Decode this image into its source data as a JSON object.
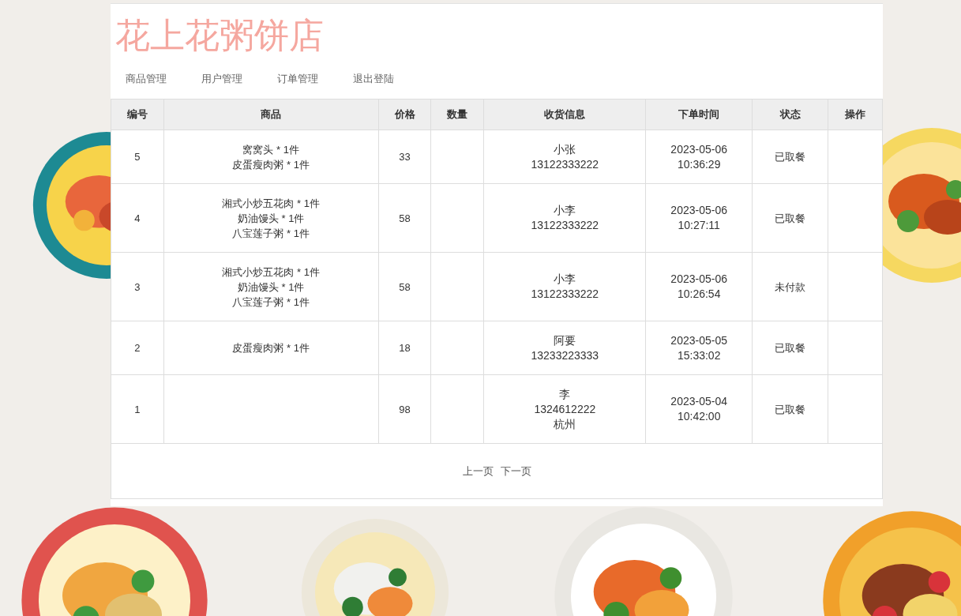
{
  "shop_title": "花上花粥饼店",
  "nav": [
    "商品管理",
    "用户管理",
    "订单管理",
    "退出登陆"
  ],
  "table": {
    "columns": [
      "编号",
      "商品",
      "价格",
      "数量",
      "收货信息",
      "下单时间",
      "状态",
      "操作"
    ],
    "rows": [
      {
        "id": "5",
        "items": [
          "窝窝头 * 1件",
          "皮蛋瘦肉粥 * 1件"
        ],
        "price": "33",
        "receiver": [
          "小张",
          "13122333222"
        ],
        "time": [
          "2023-05-06",
          "10:36:29"
        ],
        "status": "已取餐"
      },
      {
        "id": "4",
        "items": [
          "湘式小炒五花肉 * 1件",
          "奶油馒头 * 1件",
          "八宝莲子粥 * 1件"
        ],
        "price": "58",
        "receiver": [
          "小李",
          "13122333222"
        ],
        "time": [
          "2023-05-06",
          "10:27:11"
        ],
        "status": "已取餐"
      },
      {
        "id": "3",
        "items": [
          "湘式小炒五花肉 * 1件",
          "奶油馒头 * 1件",
          "八宝莲子粥 * 1件"
        ],
        "price": "58",
        "receiver": [
          "小李",
          "13122333222"
        ],
        "time": [
          "2023-05-06",
          "10:26:54"
        ],
        "status": "未付款"
      },
      {
        "id": "2",
        "items": [
          "皮蛋瘦肉粥 * 1件"
        ],
        "price": "18",
        "receiver": [
          "阿要",
          "13233223333"
        ],
        "time": [
          "2023-05-05",
          "15:33:02"
        ],
        "status": "已取餐"
      },
      {
        "id": "1",
        "items": [],
        "price": "98",
        "receiver": [
          "李",
          "1324612222",
          "杭州"
        ],
        "time": [
          "2023-05-04",
          "10:42:00"
        ],
        "status": "已取餐"
      }
    ]
  },
  "pagination": [
    "上一页",
    "下一页"
  ]
}
